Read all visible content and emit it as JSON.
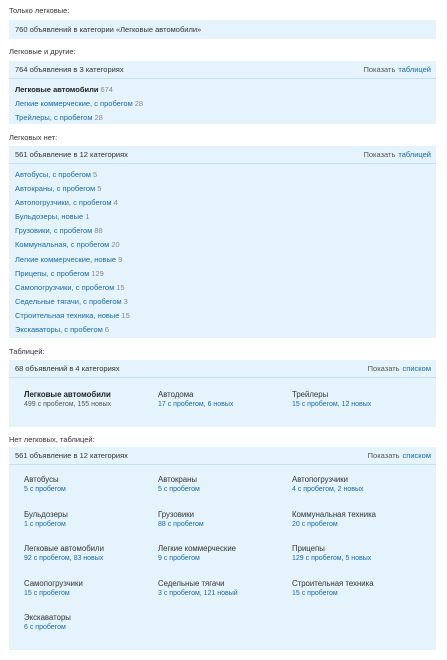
{
  "s1": {
    "label": "Только легковые:",
    "summary": "760 объявлений в категории «Легковые автомобили»"
  },
  "s2": {
    "label": "Легковые и другие:",
    "summary": "764 объявления в 3 категориях",
    "show_label": "Показать",
    "show_link": "таблицей",
    "items": [
      {
        "name": "Легковые автомобили",
        "count": "674",
        "bold": true
      },
      {
        "name": "Легкие коммерческие, с пробегом",
        "count": "28"
      },
      {
        "name": "Трейлеры, с пробегом",
        "count": "28"
      }
    ]
  },
  "s3": {
    "label": "Легковых нет:",
    "summary": "561 объявление в 12 категориях",
    "show_label": "Показать",
    "show_link": "таблицей",
    "items": [
      {
        "name": "Автобусы, с пробегом",
        "count": "5"
      },
      {
        "name": "Автокраны, с пробегом",
        "count": "5"
      },
      {
        "name": "Автопогрузчики, с пробегом",
        "count": "4"
      },
      {
        "name": "Бульдозеры, новые",
        "count": "1"
      },
      {
        "name": "Грузовики, с пробегом",
        "count": "88"
      },
      {
        "name": "Коммунальная, с пробегом",
        "count": "20"
      },
      {
        "name": "Легкие коммерческие, новые",
        "count": "9"
      },
      {
        "name": "Прицепы, с пробегом",
        "count": "129"
      },
      {
        "name": "Самопогрузчики, с пробегом",
        "count": "15"
      },
      {
        "name": "Седельные тягачи, с пробегом",
        "count": "3"
      },
      {
        "name": "Строительная техника, новые",
        "count": "15"
      },
      {
        "name": "Экскаваторы, с пробегом",
        "count": "6"
      }
    ]
  },
  "s4": {
    "label": "Таблицей:",
    "summary": "68 объявлений в 4 категориях",
    "show_label": "Показать",
    "show_link": "списком",
    "cells": [
      {
        "title": "Легковые автомобили",
        "sub": "499 с пробегом, 155 новых",
        "bold": true
      },
      {
        "title": "Автодома",
        "sub": "17 с пробегом, 6 новых"
      },
      {
        "title": "Трейлеры",
        "sub": "15 с пробегом, 12 новых"
      }
    ]
  },
  "s5": {
    "label": "Нет легковых, таблицей:",
    "summary": "561 объявление в 12 категориях",
    "show_label": "Показать",
    "show_link": "списком",
    "cells": [
      {
        "title": "Автобусы",
        "sub": "5 с пробегом"
      },
      {
        "title": "Автокраны",
        "sub": "5 с пробегом"
      },
      {
        "title": "Автопогрузчики",
        "sub": "4 с пробегом, 2 новых"
      },
      {
        "title": "Бульдозеры",
        "sub": "1 с пробегом"
      },
      {
        "title": "Грузовики",
        "sub": "88 с пробегом"
      },
      {
        "title": "Коммунальная техника",
        "sub": "20 с пробегом"
      },
      {
        "title": "Легковые автомобили",
        "sub": "92 с пробегом, 83 новых"
      },
      {
        "title": "Легкие коммерческие",
        "sub": "9 с пробегом"
      },
      {
        "title": "Прицепы",
        "sub": "129 с пробегом, 5 новых"
      },
      {
        "title": "Самопогрузчики",
        "sub": "15 с пробегом"
      },
      {
        "title": "Седельные тягачи",
        "sub": "3 с пробегом, 121 новый"
      },
      {
        "title": "Строительная техника",
        "sub": "15 с пробегом"
      },
      {
        "title": "Экскаваторы",
        "sub": "6 с пробегом"
      }
    ]
  }
}
